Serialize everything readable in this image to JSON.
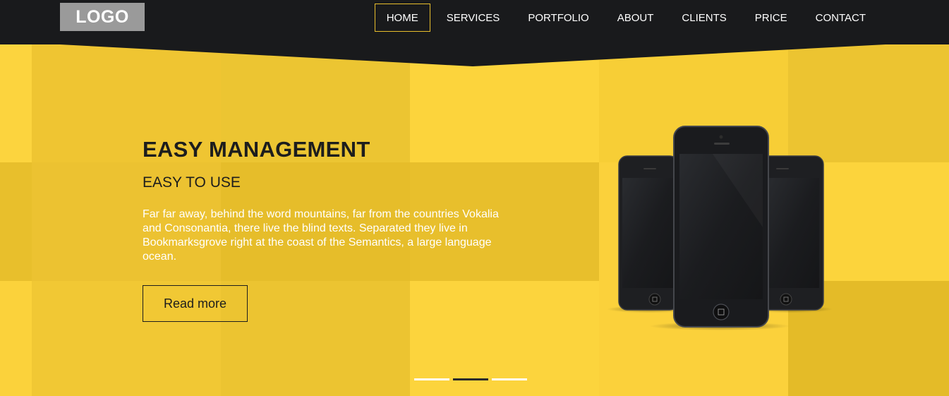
{
  "header": {
    "logo_text": "LOGO",
    "nav": [
      {
        "label": "HOME",
        "active": true
      },
      {
        "label": "SERVICES",
        "active": false
      },
      {
        "label": "PORTFOLIO",
        "active": false
      },
      {
        "label": "ABOUT",
        "active": false
      },
      {
        "label": "CLIENTS",
        "active": false
      },
      {
        "label": "PRICE",
        "active": false
      },
      {
        "label": "CONTACT",
        "active": false
      }
    ]
  },
  "hero": {
    "title": "EASY MANAGEMENT",
    "subtitle": "EASY TO USE",
    "text": "Far far away, behind the word mountains, far from the countries Vokalia and Consonantia, there live the blind texts. Separated they live in Bookmarksgrove right at the coast of the Semantics, a large language ocean.",
    "button_label": "Read more",
    "image_icon": "smartphones-illustration"
  },
  "slider": {
    "slide_count": 3,
    "active_index": 1
  },
  "colors": {
    "header_bg": "#191a1c",
    "accent_yellow": "#fbd13b",
    "nav_active_border": "#e8be2c",
    "text_dark": "#1d1d1d"
  }
}
